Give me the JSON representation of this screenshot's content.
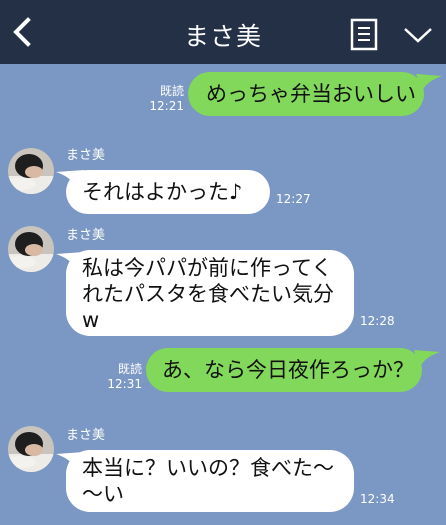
{
  "header": {
    "title": "まさ美",
    "back_icon": "chevron-left-icon",
    "notes_icon": "notes-icon",
    "menu_icon": "chevron-down-icon"
  },
  "colors": {
    "header_bg": "#243045",
    "chat_bg": "#7b97c3",
    "sent_bubble": "#82d85a",
    "received_bubble": "#ffffff"
  },
  "messages": [
    {
      "direction": "sent",
      "text": "めっちゃ弁当おいしい",
      "read": "既読",
      "time": "12:21"
    },
    {
      "direction": "received",
      "sender": "まさ美",
      "text": "それはよかった♪",
      "time": "12:27"
    },
    {
      "direction": "received",
      "sender": "まさ美",
      "lines": [
        "私は今パパが前に作ってく",
        "れたパスタを食べたい気分",
        "w"
      ],
      "time": "12:28"
    },
    {
      "direction": "sent",
      "text": "あ、なら今日夜作ろっか？",
      "read": "既読",
      "time": "12:31"
    },
    {
      "direction": "received",
      "sender": "まさ美",
      "lines": [
        "本当に？いいの？食べた〜",
        "〜い"
      ],
      "time": "12:34"
    }
  ]
}
